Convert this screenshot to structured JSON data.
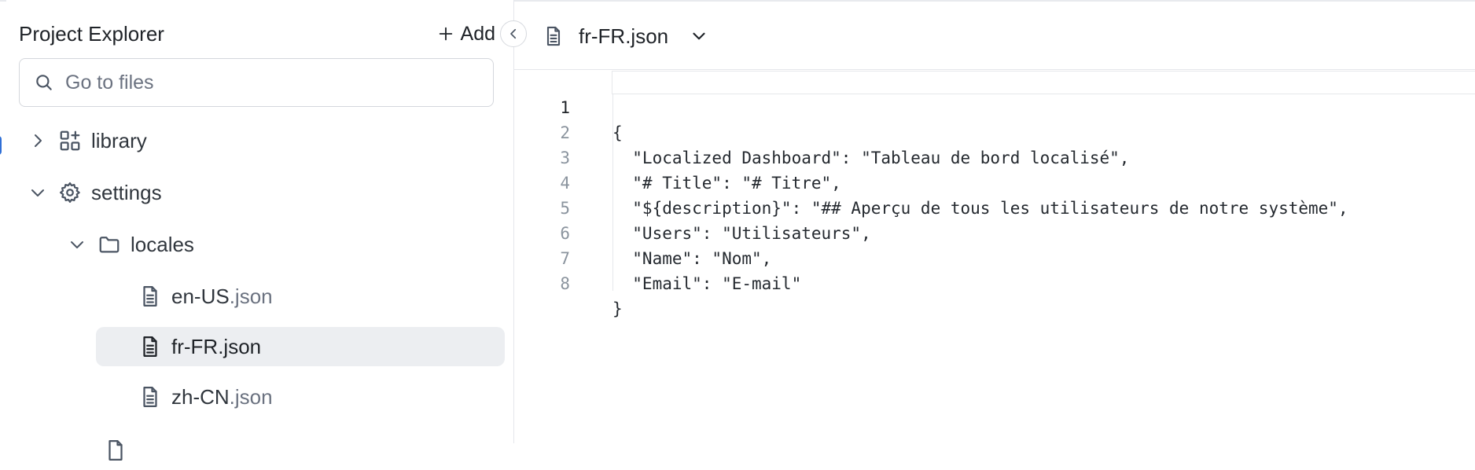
{
  "sidebar": {
    "title": "Project Explorer",
    "add_label": "Add",
    "search_placeholder": "Go to files",
    "tree": {
      "library": "library",
      "settings": "settings",
      "locales": "locales",
      "files": [
        {
          "name": "en-US",
          "ext": ".json"
        },
        {
          "name": "fr-FR",
          "ext": ".json",
          "selected": true
        },
        {
          "name": "zh-CN",
          "ext": ".json"
        }
      ]
    }
  },
  "tab": {
    "label": "fr-FR.json"
  },
  "editor": {
    "active_line": 1,
    "lines": [
      {
        "n": "1",
        "text": "{"
      },
      {
        "n": "2",
        "text": "  \"Localized Dashboard\": \"Tableau de bord localisé\","
      },
      {
        "n": "3",
        "text": "  \"# Title\": \"# Titre\","
      },
      {
        "n": "4",
        "text": "  \"${description}\": \"## Aperçu de tous les utilisateurs de notre système\","
      },
      {
        "n": "5",
        "text": "  \"Users\": \"Utilisateurs\","
      },
      {
        "n": "6",
        "text": "  \"Name\": \"Nom\","
      },
      {
        "n": "7",
        "text": "  \"Email\": \"E-mail\""
      },
      {
        "n": "8",
        "text": "}"
      }
    ]
  },
  "colors": {
    "selected_bg": "#eceef1",
    "accent": "#2f6fd6",
    "muted_text": "#6b7280"
  }
}
